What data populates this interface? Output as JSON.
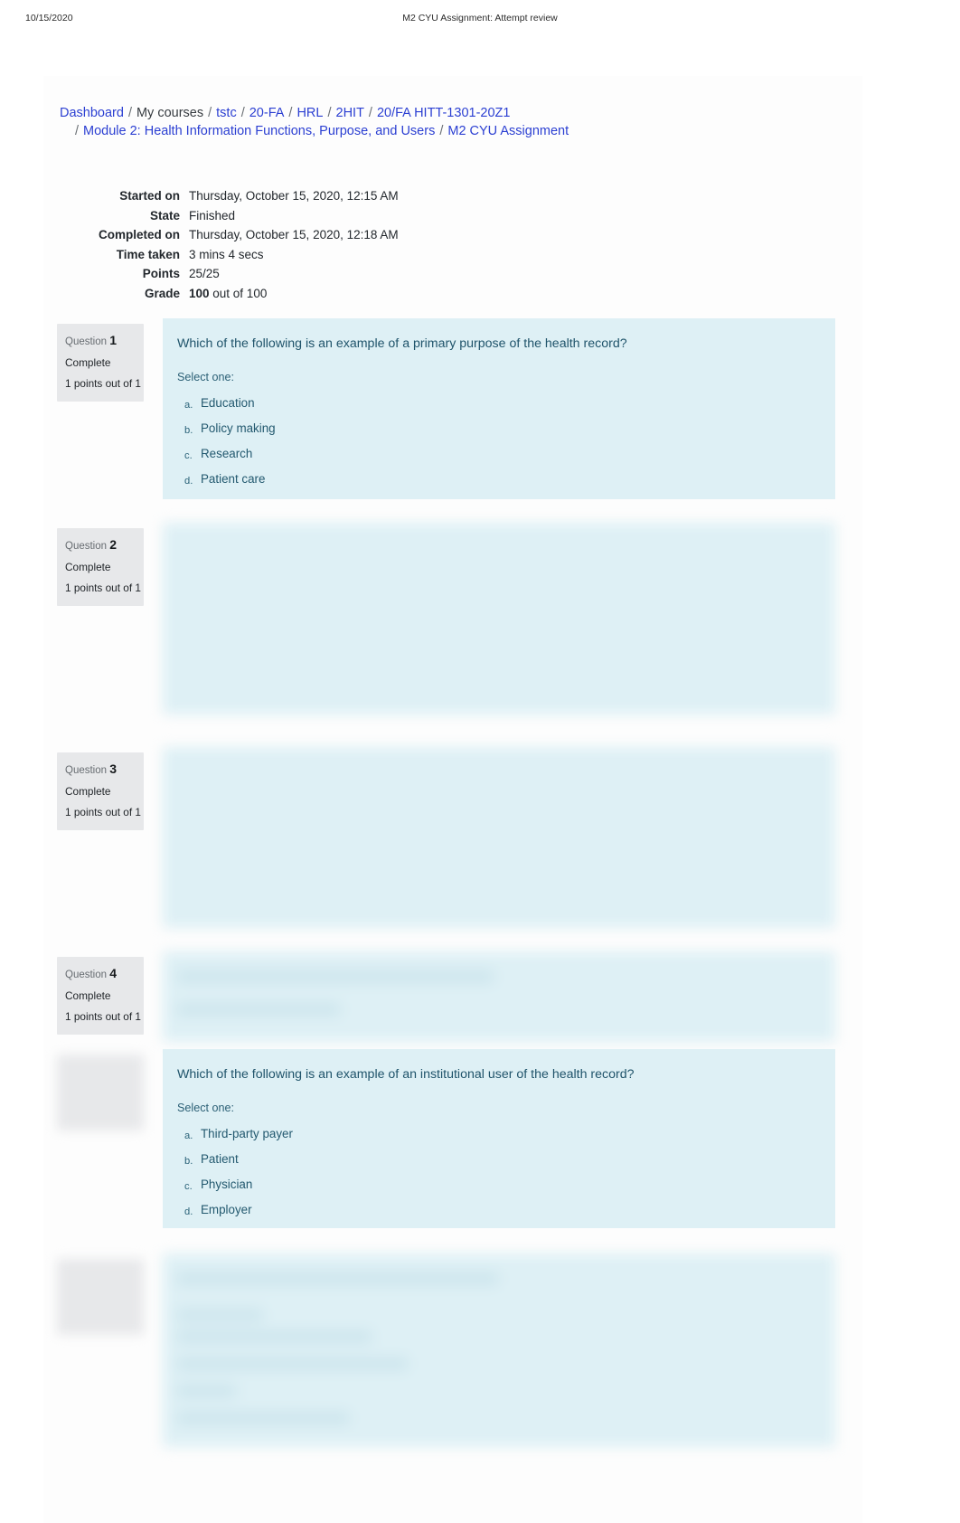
{
  "print_header": {
    "date": "10/15/2020",
    "title": "M2 CYU Assignment: Attempt review"
  },
  "breadcrumb": {
    "line1": [
      {
        "label": "Dashboard",
        "type": "link"
      },
      {
        "label": "My courses",
        "type": "plain"
      },
      {
        "label": "tstc",
        "type": "link"
      },
      {
        "label": "20-FA",
        "type": "link"
      },
      {
        "label": "HRL",
        "type": "link"
      },
      {
        "label": "2HIT",
        "type": "link"
      },
      {
        "label": "20/FA HITT-1301-20Z1",
        "type": "link"
      }
    ],
    "line2": [
      {
        "label": "Module 2: Health Information Functions, Purpose, and Users",
        "type": "link"
      },
      {
        "label": "M2 CYU Assignment",
        "type": "link"
      }
    ],
    "separator": "/"
  },
  "summary": {
    "rows": [
      {
        "label": "Started on",
        "value": "Thursday, October 15, 2020, 12:15 AM"
      },
      {
        "label": "State",
        "value": "Finished"
      },
      {
        "label": "Completed on",
        "value": "Thursday, October 15, 2020, 12:18 AM"
      },
      {
        "label": "Time taken",
        "value": "3 mins 4 secs"
      },
      {
        "label": "Points",
        "value": "25/25"
      }
    ],
    "grade": {
      "label": "Grade",
      "value_bold": "100",
      "value_rest": "out of 100"
    }
  },
  "questions": [
    {
      "number_label": "Question",
      "number": "1",
      "state": "Complete",
      "mark": "1 points out of 1",
      "text": "Which of the following is an example of a primary purpose of the health record?",
      "select_label": "Select one:",
      "answers": [
        {
          "letter": "a.",
          "text": "Education"
        },
        {
          "letter": "b.",
          "text": "Policy making"
        },
        {
          "letter": "c.",
          "text": "Research"
        },
        {
          "letter": "d.",
          "text": "Patient care"
        }
      ],
      "blurred": false,
      "info_blurred": false
    },
    {
      "number_label": "Question",
      "number": "2",
      "state": "Complete",
      "mark": "1 points out of 1",
      "text": "",
      "select_label": "",
      "answers": [],
      "blurred": true,
      "info_blurred": false
    },
    {
      "number_label": "Question",
      "number": "3",
      "state": "Complete",
      "mark": "1 points out of 1",
      "text": "",
      "select_label": "",
      "answers": [],
      "blurred": true,
      "info_blurred": false
    },
    {
      "number_label": "Question",
      "number": "4",
      "state": "Complete",
      "mark": "1 points out of 1",
      "text": "",
      "select_label": "",
      "answers": [],
      "blurred": true,
      "info_blurred": false
    },
    {
      "number_label": "",
      "number": "",
      "state": "",
      "mark": "",
      "text": "Which of the following is an example of an institutional user of the health record?",
      "select_label": "Select one:",
      "answers": [
        {
          "letter": "a.",
          "text": "Third-party payer"
        },
        {
          "letter": "b.",
          "text": "Patient"
        },
        {
          "letter": "c.",
          "text": "Physician"
        },
        {
          "letter": "d.",
          "text": "Employer"
        }
      ],
      "blurred": false,
      "info_blurred": true
    },
    {
      "number_label": "",
      "number": "",
      "state": "",
      "mark": "",
      "text": "",
      "select_label": "",
      "answers": [],
      "blurred": true,
      "info_blurred": true
    }
  ]
}
